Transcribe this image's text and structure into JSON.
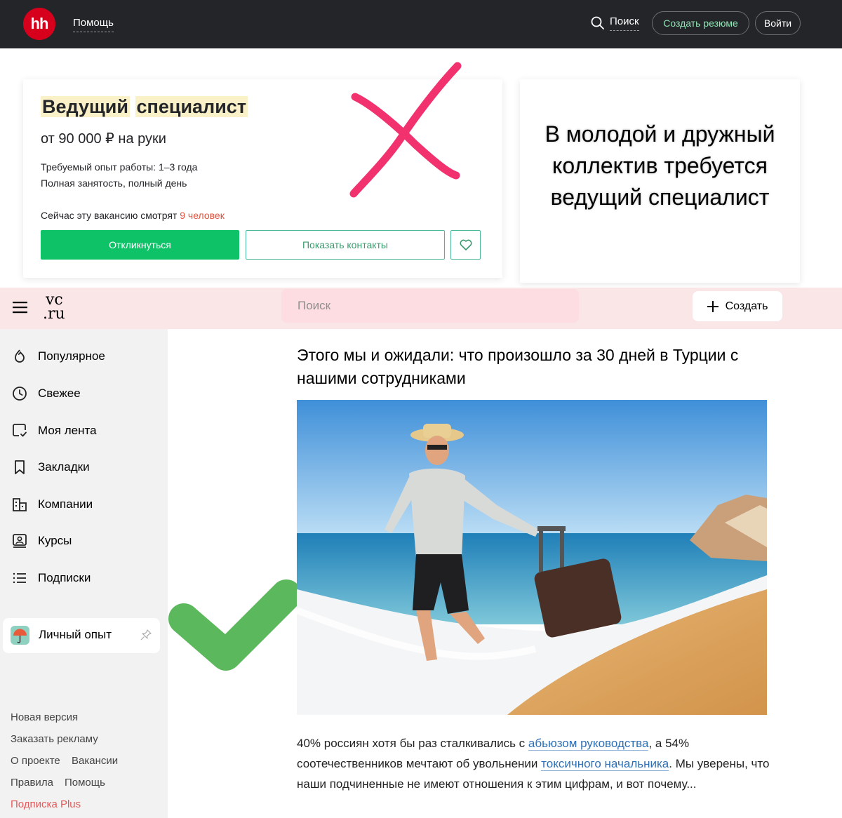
{
  "hh_header": {
    "logo": "hh",
    "help": "Помощь",
    "search": "Поиск",
    "create_resume": "Создать резюме",
    "login": "Войти"
  },
  "vacancy": {
    "title_word1": "Ведущий",
    "title_word2": "специалист",
    "salary": "от 90 000 ₽ на руки",
    "experience": "Требуемый опыт работы: 1–3 года",
    "employment": "Полная занятость, полный день",
    "watching_prefix": "Сейчас эту вакансию смотрят ",
    "watching_count": "9 человек",
    "apply_button": "Откликнуться",
    "contacts_button": "Показать контакты"
  },
  "quote": {
    "line1": "В молодой и дружный",
    "line2": "коллектив требуется",
    "line3": "ведущий специалист"
  },
  "vc_header": {
    "logo_top": "vc",
    "logo_bottom": ".ru",
    "search_placeholder": "Поиск",
    "create_button": "Создать"
  },
  "sidebar": {
    "items": [
      {
        "label": "Популярное",
        "icon": "fire-icon"
      },
      {
        "label": "Свежее",
        "icon": "clock-icon"
      },
      {
        "label": "Моя лента",
        "icon": "feed-icon"
      },
      {
        "label": "Закладки",
        "icon": "bookmark-icon"
      },
      {
        "label": "Компании",
        "icon": "companies-icon"
      },
      {
        "label": "Курсы",
        "icon": "courses-icon"
      },
      {
        "label": "Подписки",
        "icon": "list-icon"
      }
    ],
    "special": {
      "label": "Личный опыт",
      "icon": "umbrella-icon"
    },
    "footer": {
      "new_version": "Новая версия",
      "order_ads": "Заказать рекламу",
      "about": "О проекте",
      "vacancies": "Вакансии",
      "rules": "Правила",
      "help": "Помощь",
      "subscription_plus": "Подписка Plus"
    }
  },
  "article": {
    "title": "Этого мы и ожидали: что произошло за 30 дней в Турции с нашими сотрудниками",
    "text_1": "40% россиян хотя бы раз сталкивались с ",
    "link_1": "абьюзом руководства",
    "text_2": ", а 54% соотечественников мечтают об увольнении ",
    "link_2": "токсичного начальника",
    "text_3": ". Мы уверены, что наши подчиненные не имеют отношения к этим цифрам, и вот почему..."
  },
  "colors": {
    "hh_bar": "#232529",
    "hh_red": "#d6001c",
    "hh_green": "#0dc267",
    "cross": "#f2326f",
    "check": "#5cb85c",
    "vc_bar": "#fae5e7",
    "link": "#2f6fb4",
    "plus": "#e25a5a"
  }
}
